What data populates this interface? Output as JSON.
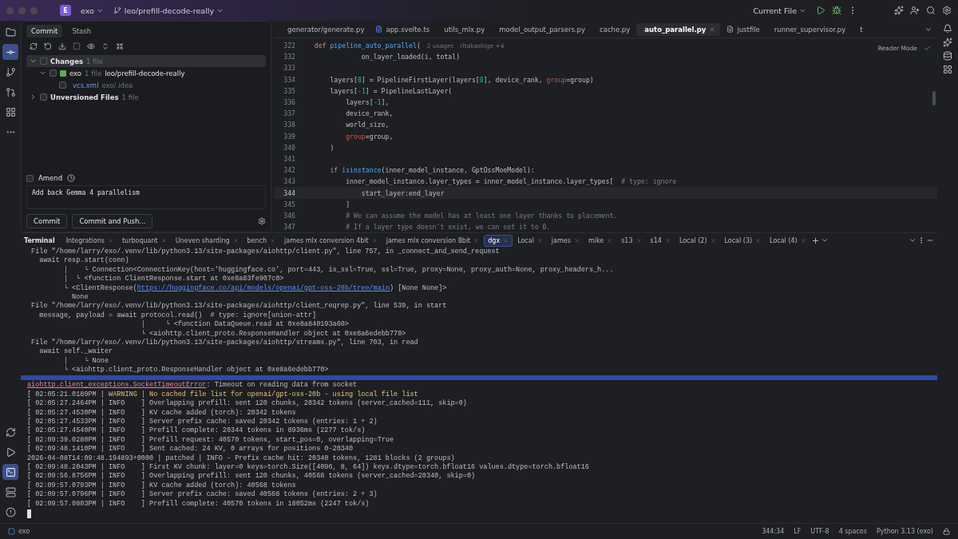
{
  "title_bar": {
    "project_badge": "E",
    "project": "exo",
    "branch": "leo/prefill-decode-really",
    "run_config": "Current File"
  },
  "left_toolbar": {
    "top": [
      {
        "kind": "folder",
        "selected": false
      },
      {
        "kind": "commit",
        "selected": true
      },
      {
        "kind": "branch",
        "selected": false
      },
      {
        "kind": "pull-request",
        "selected": false
      },
      {
        "kind": "structure",
        "selected": false
      },
      {
        "kind": "more",
        "selected": false
      }
    ],
    "bottom": [
      {
        "kind": "sync",
        "selected": false
      },
      {
        "kind": "run",
        "selected": false
      },
      {
        "kind": "terminal",
        "selected": true
      },
      {
        "kind": "services",
        "selected": false
      },
      {
        "kind": "problems",
        "selected": false
      }
    ]
  },
  "commit_panel": {
    "tabs": [
      {
        "label": "Commit",
        "selected": true
      },
      {
        "label": "Stash",
        "selected": false
      }
    ],
    "tree": [
      {
        "kind": "group",
        "label": "Changes",
        "count": "1 file",
        "expanded": true,
        "checked": false,
        "selected": true,
        "children": [
          {
            "kind": "repo",
            "label": "exo",
            "count": "1 file",
            "branch": "leo/prefill-decode-really",
            "expanded": true,
            "checked": false,
            "selected": false,
            "children": [
              {
                "kind": "file",
                "label": "vcs.xml",
                "path": "exo/.idea",
                "checked": false,
                "selected": false
              }
            ]
          }
        ]
      },
      {
        "kind": "group",
        "label": "Unversioned Files",
        "count": "1 file",
        "expanded": false,
        "checked": false,
        "selected": false
      }
    ],
    "amend": {
      "label": "Amend",
      "checked": false
    },
    "message": "Add back Gemma 4 parallelism",
    "buttons": [
      "Commit",
      "Commit and Push..."
    ]
  },
  "editor": {
    "tabs": [
      {
        "label": "generator/generate.py",
        "kind": "py",
        "selected": false
      },
      {
        "label": "app.svelte.ts",
        "kind": "ts",
        "selected": false
      },
      {
        "label": "utils_mlx.py",
        "kind": "py",
        "selected": false
      },
      {
        "label": "model_output_parsers.py",
        "kind": "py",
        "selected": false
      },
      {
        "label": "cache.py",
        "kind": "py",
        "selected": false
      },
      {
        "label": "auto_parallel.py",
        "kind": "py",
        "selected": true
      },
      {
        "label": "justfile",
        "kind": "text",
        "selected": false
      },
      {
        "label": "runner_supervisor.py",
        "kind": "py",
        "selected": false
      },
      {
        "label": "t",
        "kind": "py",
        "selected": false
      }
    ],
    "reader_mode": "Reader Mode",
    "sticky": {
      "number": "322",
      "segments": [
        {
          "text": "    def ",
          "kind": "kw"
        },
        {
          "text": "pipeline_auto_parallel",
          "kind": "fn"
        },
        {
          "text": "(",
          "kind": "plain"
        }
      ],
      "hints": [
        "2 usages",
        "rltakashige +4"
      ]
    },
    "lines": [
      {
        "number": "332",
        "current": false,
        "segments": [
          {
            "text": "                on_layer_loaded(i, total)",
            "kind": "plain"
          }
        ]
      },
      {
        "number": "333",
        "current": false
      },
      {
        "number": "334",
        "current": false,
        "segments": [
          {
            "text": "        layers[",
            "kind": "plain"
          },
          {
            "text": "0",
            "kind": "num"
          },
          {
            "text": "] = PipelineFirstLayer(layers[",
            "kind": "plain"
          },
          {
            "text": "0",
            "kind": "num"
          },
          {
            "text": "], device_rank, ",
            "kind": "plain"
          },
          {
            "text": "group",
            "kind": "param"
          },
          {
            "text": "=group)",
            "kind": "plain"
          }
        ]
      },
      {
        "number": "335",
        "current": false,
        "segments": [
          {
            "text": "        layers[",
            "kind": "plain"
          },
          {
            "text": "-1",
            "kind": "num"
          },
          {
            "text": "] = PipelineLastLayer(",
            "kind": "plain"
          }
        ]
      },
      {
        "number": "336",
        "current": false,
        "segments": [
          {
            "text": "            layers[",
            "kind": "plain"
          },
          {
            "text": "-1",
            "kind": "num"
          },
          {
            "text": "],",
            "kind": "plain"
          }
        ]
      },
      {
        "number": "337",
        "current": false,
        "segments": [
          {
            "text": "            device_rank,",
            "kind": "plain"
          }
        ]
      },
      {
        "number": "338",
        "current": false,
        "segments": [
          {
            "text": "            world_size,",
            "kind": "plain"
          }
        ]
      },
      {
        "number": "339",
        "current": false,
        "segments": [
          {
            "text": "            group",
            "kind": "param"
          },
          {
            "text": "=group,",
            "kind": "plain"
          }
        ]
      },
      {
        "number": "340",
        "current": false,
        "segments": [
          {
            "text": "        )",
            "kind": "plain"
          }
        ]
      },
      {
        "number": "341",
        "current": false
      },
      {
        "number": "342",
        "current": false,
        "segments": [
          {
            "text": "        if ",
            "kind": "kw"
          },
          {
            "text": "isinstance",
            "kind": "fn"
          },
          {
            "text": "(inner_model_instance, GptOssMoeModel):",
            "kind": "plain"
          }
        ]
      },
      {
        "number": "343",
        "current": false,
        "segments": [
          {
            "text": "            inner_model_instance.layer_types = inner_model_instance.layer_types[  ",
            "kind": "plain"
          },
          {
            "text": "# type: ignore",
            "kind": "comment"
          }
        ]
      },
      {
        "number": "344",
        "current": true,
        "segments": [
          {
            "text": "                start_layer:end_layer",
            "kind": "plain"
          }
        ]
      },
      {
        "number": "345",
        "current": false,
        "segments": [
          {
            "text": "            ]",
            "kind": "plain"
          }
        ]
      },
      {
        "number": "346",
        "current": false,
        "segments": [
          {
            "text": "            # We can assume the model has at least one layer thanks to placement.",
            "kind": "comment"
          }
        ]
      },
      {
        "number": "347",
        "current": false,
        "segments": [
          {
            "text": "            # If a layer type doesn't exist, we can set it to 0.",
            "kind": "comment"
          }
        ]
      }
    ]
  },
  "terminal": {
    "label": "Terminal",
    "tabs": [
      {
        "label": "Integrations",
        "selected": false
      },
      {
        "label": "turboquant",
        "selected": false
      },
      {
        "label": "Uneven sharding",
        "selected": false
      },
      {
        "label": "bench",
        "selected": false
      },
      {
        "label": "james mlx conversion 4bit",
        "selected": false
      },
      {
        "label": "james mlx conversion 8bit",
        "selected": false
      },
      {
        "label": "dgx",
        "selected": true
      },
      {
        "label": "Local",
        "selected": false
      },
      {
        "label": "james",
        "selected": false
      },
      {
        "label": "mike",
        "selected": false
      },
      {
        "label": "s13",
        "selected": false
      },
      {
        "label": "s14",
        "selected": false
      },
      {
        "label": "Local (2)",
        "selected": false
      },
      {
        "label": "Local (3)",
        "selected": false
      },
      {
        "label": "Local (4)",
        "selected": false
      }
    ],
    "lines": [
      {
        "segments": [
          {
            "text": " File \"/home/larry/exo/.venv/lib/python3.13/site-packages/aiohttp/client.py\", line 757, in _connect_and_send_request",
            "kind": "plain"
          }
        ]
      },
      {
        "segments": [
          {
            "text": "   await resp.start(conn)",
            "kind": "plain"
          }
        ]
      },
      {
        "segments": [
          {
            "text": "         │    └ Connection<ConnectionKey(host='huggingface.co', port=443, is_ssl=True, ssl=True, proxy=None, proxy_auth=None, proxy_headers_h...",
            "kind": "plain"
          }
        ]
      },
      {
        "segments": [
          {
            "text": "         │  └ <function ClientResponse.start at 0xe8a83fe907c0>",
            "kind": "plain"
          }
        ]
      },
      {
        "segments": [
          {
            "text": "         └ <ClientResponse(",
            "kind": "plain"
          },
          {
            "text": "https://huggingface.co/api/models/openai/gpt-oss-20b/tree/main",
            "kind": "link"
          },
          {
            "text": ") [None None]>",
            "kind": "plain"
          }
        ]
      },
      {
        "segments": [
          {
            "text": "           None",
            "kind": "plain"
          }
        ]
      },
      {
        "segments": [
          {
            "text": " File \"/home/larry/exo/.venv/lib/python3.13/site-packages/aiohttp/client_reqrep.py\", line 539, in start",
            "kind": "plain"
          }
        ]
      },
      {
        "segments": [
          {
            "text": "   message, payload = await protocol.read()  # type: ignore[union-attr]",
            "kind": "plain"
          }
        ]
      },
      {
        "segments": [
          {
            "text": "                            │     └ <function DataQueue.read at 0xe8a840193a60>",
            "kind": "plain"
          }
        ]
      },
      {
        "segments": [
          {
            "text": "                            └ <aiohttp.client_proto.ResponseHandler object at 0xe8a6edebb770>",
            "kind": "plain"
          }
        ]
      },
      {
        "segments": [
          {
            "text": " File \"/home/larry/exo/.venv/lib/python3.13/site-packages/aiohttp/streams.py\", line 703, in read",
            "kind": "plain"
          }
        ]
      },
      {
        "segments": [
          {
            "text": "   await self._waiter",
            "kind": "plain"
          }
        ]
      },
      {
        "segments": [
          {
            "text": "         │    └ None",
            "kind": "plain"
          }
        ]
      },
      {
        "segments": [
          {
            "text": "         └ <aiohttp.client_proto.ResponseHandler object at 0xe8a6edebb770>",
            "kind": "plain"
          }
        ]
      },
      {
        "kind": "divider"
      },
      {
        "segments": [
          {
            "text": "aiohttp.client_exceptions.SocketTimeoutError",
            "kind": "error"
          },
          {
            "text": ": Timeout on reading data from socket",
            "kind": "plain"
          }
        ]
      },
      {
        "segments": [
          {
            "text": "[ 02:05:21.0189PM | ",
            "kind": "plain"
          },
          {
            "text": "WARNING",
            "kind": "warn"
          },
          {
            "text": " | ",
            "kind": "plain"
          },
          {
            "text": "No cached file list for openai/gpt-oss-20b - using local file list",
            "kind": "warn"
          }
        ]
      },
      {
        "segments": [
          {
            "text": "[ 02:05:27.2464PM | INFO    ] Overlapping prefill: sent 120 chunks, 20342 tokens (server_cached=111, skip=0)",
            "kind": "plain"
          }
        ]
      },
      {
        "segments": [
          {
            "text": "[ 02:05:27.4530PM | INFO    ] KV cache added (torch): 20342 tokens",
            "kind": "plain"
          }
        ]
      },
      {
        "segments": [
          {
            "text": "[ 02:05:27.4533PM | INFO    ] Server prefix cache: saved 20342 tokens (entries: 1 + 2)",
            "kind": "plain"
          }
        ]
      },
      {
        "segments": [
          {
            "text": "[ 02:05:27.4540PM | INFO    ] Prefill complete: 20344 tokens in 8936ms (2277 tok/s)",
            "kind": "plain"
          }
        ]
      },
      {
        "segments": [
          {
            "text": "[ 02:09:39.0280PM | INFO    ] Prefill request: 40570 tokens, start_pos=0, overlapping=True",
            "kind": "plain"
          }
        ]
      },
      {
        "segments": [
          {
            "text": "[ 02:09:48.1410PM | INFO    ] Sent cached: 24 KV, 0 arrays for positions 0-20340",
            "kind": "plain"
          }
        ]
      },
      {
        "segments": [
          {
            "text": "2026-04-08T14:09:48.194893+0000 | patched | INFO - Prefix cache hit: 20340 tokens, 1281 blocks (2 groups)",
            "kind": "plain"
          }
        ]
      },
      {
        "segments": [
          {
            "text": "[ 02:09:48.2043PM | INFO    ] First KV chunk: layer=0 keys=torch.Size([4096, 8, 64]) keys.dtype=torch.bfloat16 values.dtype=torch.bfloat16",
            "kind": "plain"
          }
        ]
      },
      {
        "segments": [
          {
            "text": "[ 02:09:56.8756PM | INFO    ] Overlapping prefill: sent 120 chunks, 40568 tokens (server_cached=20340, skip=0)",
            "kind": "plain"
          }
        ]
      },
      {
        "segments": [
          {
            "text": "[ 02:09:57.0793PM | INFO    ] KV cache added (torch): 40568 tokens",
            "kind": "plain"
          }
        ]
      },
      {
        "segments": [
          {
            "text": "[ 02:09:57.0796PM | INFO    ] Server prefix cache: saved 40568 tokens (entries: 2 + 3)",
            "kind": "plain"
          }
        ]
      },
      {
        "segments": [
          {
            "text": "[ 02:09:57.0803PM | INFO    ] Prefill complete: 40570 tokens in 18052ms (2247 tok/s)",
            "kind": "plain"
          }
        ]
      },
      {
        "kind": "cursor"
      }
    ]
  },
  "status_bar": {
    "project": "exo",
    "items": [
      "344:34",
      "LF",
      "UTF-8",
      "4 spaces",
      "Python 3.13 (exo)"
    ]
  }
}
